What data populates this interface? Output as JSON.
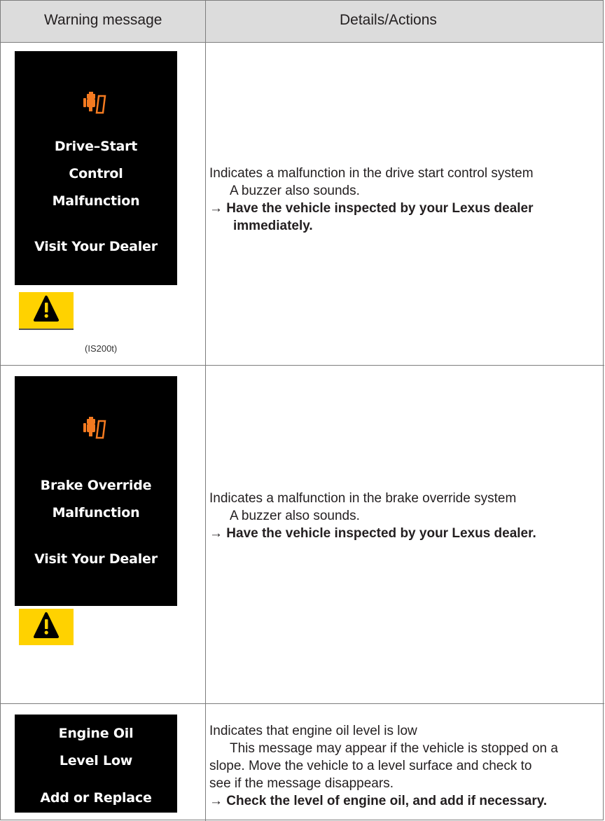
{
  "header": {
    "col1": "Warning message",
    "col2": "Details/Actions"
  },
  "rows": [
    {
      "screen_lines": [
        "Drive–Start",
        "Control",
        "Malfunction",
        "Visit Your Dealer"
      ],
      "model": "(IS200t)",
      "indicates": "Indicates a malfunction in the drive start control system",
      "note": "A buzzer also sounds.",
      "action_arrow": "→",
      "action_line1": "Have the vehicle inspected by your Lexus dealer",
      "action_line2": "immediately."
    },
    {
      "screen_lines": [
        "Brake Override",
        "Malfunction",
        "Visit Your Dealer"
      ],
      "indicates": "Indicates a malfunction in the brake override system",
      "note": "A buzzer also sounds.",
      "action_arrow": "→",
      "action_line1": "Have the vehicle inspected by your Lexus dealer."
    },
    {
      "screen_lines": [
        "Engine Oil",
        "Level Low",
        "Add or Replace"
      ],
      "indicates": "Indicates that engine oil level is low",
      "note_line1": "This message may appear if the vehicle is stopped on a",
      "note_line2": "slope. Move the vehicle to a level surface and check to",
      "note_line3": "see if the message disappears.",
      "action_arrow": "→",
      "action_line1": "Check the level of engine oil, and add if necessary."
    }
  ],
  "colors": {
    "icon_orange": "#f47a20",
    "warning_yellow": "#ffd200",
    "header_gray": "#dcdcdc"
  },
  "icons": [
    "engine-start-malfunction-icon",
    "warning-triangle-icon"
  ]
}
